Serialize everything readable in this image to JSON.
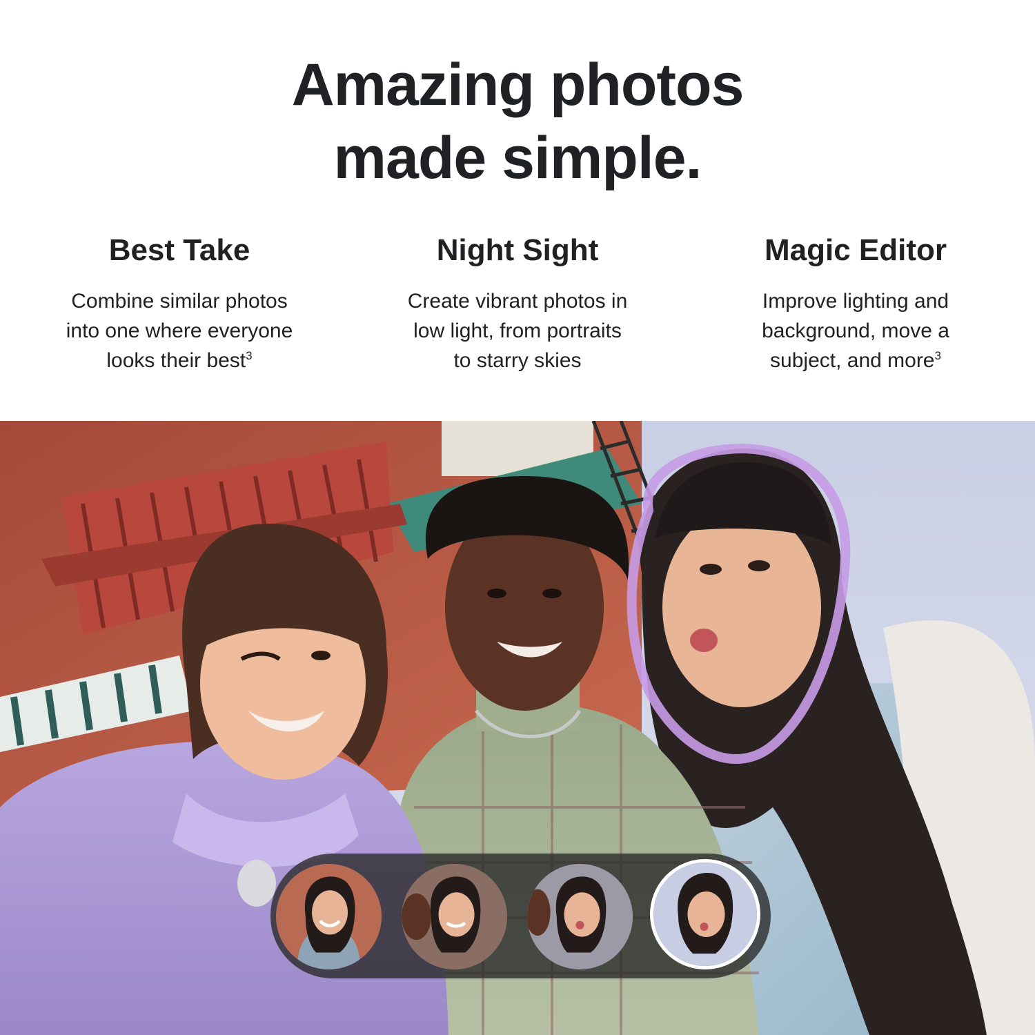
{
  "headline": {
    "line1": "Amazing photos",
    "line2": "made simple."
  },
  "features": [
    {
      "title": "Best Take",
      "lines": [
        "Combine similar photos",
        "into one where everyone",
        "looks their best"
      ],
      "footnote": "3"
    },
    {
      "title": "Night Sight",
      "lines": [
        "Create vibrant photos in",
        "low light, from portraits",
        "to starry skies"
      ],
      "footnote": ""
    },
    {
      "title": "Magic Editor",
      "lines": [
        "Improve lighting and",
        "background, move a",
        "subject, and more"
      ],
      "footnote": "3"
    }
  ],
  "photo": {
    "highlight_color": "#c79be6",
    "thumbnails": [
      {
        "selected": false
      },
      {
        "selected": false
      },
      {
        "selected": false
      },
      {
        "selected": true
      }
    ]
  }
}
